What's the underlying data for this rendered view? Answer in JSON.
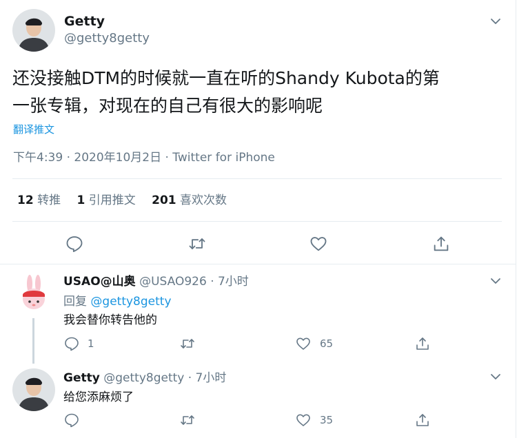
{
  "main_tweet": {
    "author_name": "Getty",
    "author_handle": "@getty8getty",
    "text_line1": "还没接触DTM的时候就一直在听的Shandy Kubota的第",
    "text_line2": "一张专辑，对现在的自己有很大的影响呢",
    "translate_label": "翻译推文",
    "meta": "下午4:39 · 2020年10月2日 · Twitter for iPhone",
    "stats": {
      "retweets_count": "12",
      "retweets_label": "转推",
      "quotes_count": "1",
      "quotes_label": "引用推文",
      "likes_count": "201",
      "likes_label": "喜欢次数"
    }
  },
  "replies": [
    {
      "author_name": "USAO@山奥",
      "author_handle": "@USAO926",
      "time": "· 7小时",
      "reply_prefix": "回复",
      "reply_to": "@getty8getty",
      "text": "我会替你转告他的",
      "reply_count": "1",
      "retweet_count": "",
      "like_count": "65"
    },
    {
      "author_name": "Getty",
      "author_handle": "@getty8getty",
      "time": "· 7小时",
      "text": "给您添麻烦了",
      "reply_count": "",
      "retweet_count": "",
      "like_count": "35"
    }
  ],
  "icons": [
    "chevron-down-icon",
    "reply-icon",
    "retweet-icon",
    "like-icon",
    "share-icon"
  ],
  "colors": {
    "text": "#14171a",
    "secondary": "#657786",
    "link": "#1b95e0",
    "divider": "#e6ecf0"
  }
}
